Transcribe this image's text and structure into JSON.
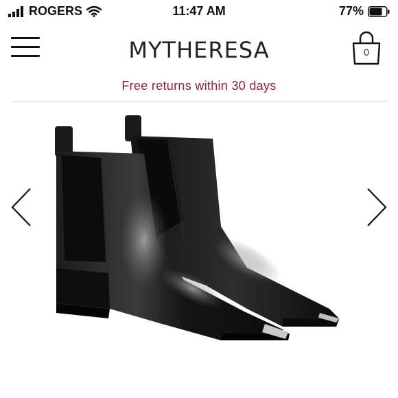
{
  "status_bar": {
    "carrier": "ROGERS",
    "time": "11:47 AM",
    "battery_percent": "77%",
    "battery_level": 0.77,
    "icons": [
      "signal-icon",
      "wifi-icon",
      "battery-icon"
    ]
  },
  "header": {
    "logo": "MYTHERESA",
    "cart_count": "0",
    "icons": [
      "hamburger-menu-icon",
      "shopping-bag-icon"
    ]
  },
  "promo": {
    "text": "Free returns within 30 days"
  },
  "carousel": {
    "image_subject": "black-leather-chelsea-ankle-boots",
    "icons": [
      "chevron-left-icon",
      "chevron-right-icon"
    ]
  },
  "colors": {
    "promo": "#8a1f3f",
    "text": "#111111",
    "divider": "#d9d9d9",
    "background": "#ffffff"
  }
}
